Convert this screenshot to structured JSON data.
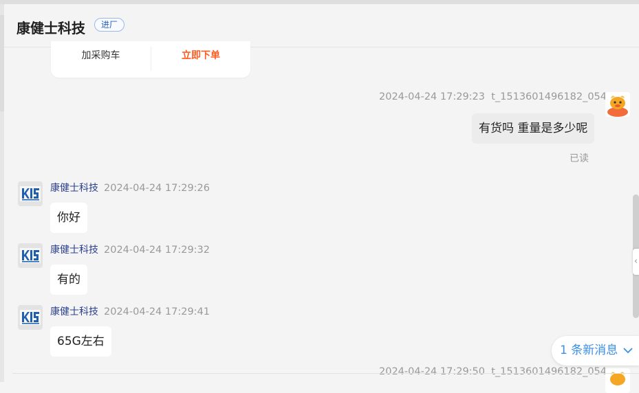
{
  "header": {
    "title": "康健士科技",
    "badge": "进厂"
  },
  "product_card": {
    "add_to_cart": "加采购车",
    "buy_now": "立即下单"
  },
  "messages": [
    {
      "side": "right",
      "timestamp": "2024-04-24 17:29:23",
      "user": "t_1513601496182_054",
      "text": "有货吗 重量是多少呢",
      "status": "已读"
    },
    {
      "side": "left",
      "sender": "康健士科技",
      "timestamp": "2024-04-24 17:29:26",
      "text": "你好"
    },
    {
      "side": "left",
      "sender": "康健士科技",
      "timestamp": "2024-04-24 17:29:32",
      "text": "有的"
    },
    {
      "side": "left",
      "sender": "康健士科技",
      "timestamp": "2024-04-24 17:29:41",
      "text": "65G左右"
    },
    {
      "side": "right",
      "timestamp": "2024-04-24 17:29:50",
      "user": "t_1513601496182_054"
    }
  ],
  "new_messages": {
    "label": "1 条新消息",
    "icon": "chevron-down-icon"
  },
  "colors": {
    "accent": "#3a8ee6",
    "buy": "#ff5a1f",
    "sender": "#2a3f8f"
  }
}
